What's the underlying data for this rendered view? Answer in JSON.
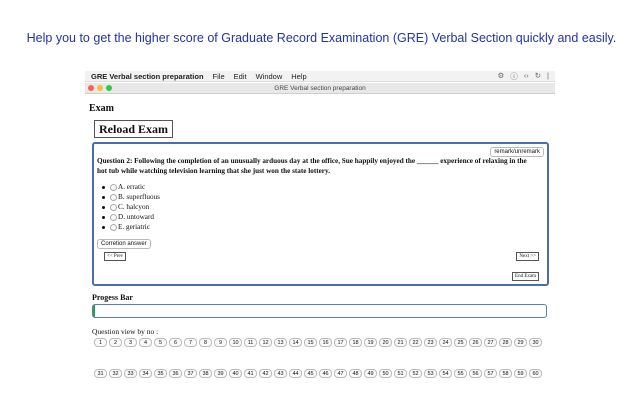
{
  "headline": "Help you to get the higher score of Graduate Record Examination (GRE) Verbal Section quickly and easily.",
  "menubar": {
    "app": "GRE Verbal section preparation",
    "items": [
      "File",
      "Edit",
      "Window",
      "Help"
    ],
    "tray": [
      "⚙",
      "ⓘ",
      "‹›",
      "↻",
      "|"
    ]
  },
  "window": {
    "title": "GRE Verbal section preparation"
  },
  "exam": {
    "label": "Exam",
    "reload": "Reload Exam",
    "remark": "remark/unremark",
    "question": "Question 2: Following the completion of an unusually arduous day at the office, Sue happily enjoyed the ______ experience of relaxing in the hot tub while watching television learning that she just won the state lottery.",
    "options": [
      "A. erratic",
      "B. superfluous",
      "C. halcyon",
      "D. untoward",
      "E. geriatric"
    ],
    "correction": "Corretion answer",
    "prev": "<< Prev",
    "next": "Next >>",
    "end": "End Exam"
  },
  "progress": {
    "label": "Progess Bar",
    "value": 0.005
  },
  "question_view": {
    "label": "Question view by no :",
    "row1": [
      "1",
      "2",
      "3",
      "4",
      "5",
      "6",
      "7",
      "8",
      "9",
      "10",
      "11",
      "12",
      "13",
      "14",
      "15",
      "16",
      "17",
      "18",
      "19",
      "20",
      "21",
      "22",
      "23",
      "24",
      "25",
      "26",
      "27",
      "28",
      "29",
      "30"
    ],
    "row2": [
      "31",
      "32",
      "33",
      "34",
      "35",
      "36",
      "37",
      "38",
      "39",
      "40",
      "41",
      "42",
      "43",
      "44",
      "45",
      "46",
      "47",
      "48",
      "49",
      "50",
      "51",
      "52",
      "53",
      "54",
      "55",
      "56",
      "57",
      "58",
      "59",
      "60"
    ]
  }
}
